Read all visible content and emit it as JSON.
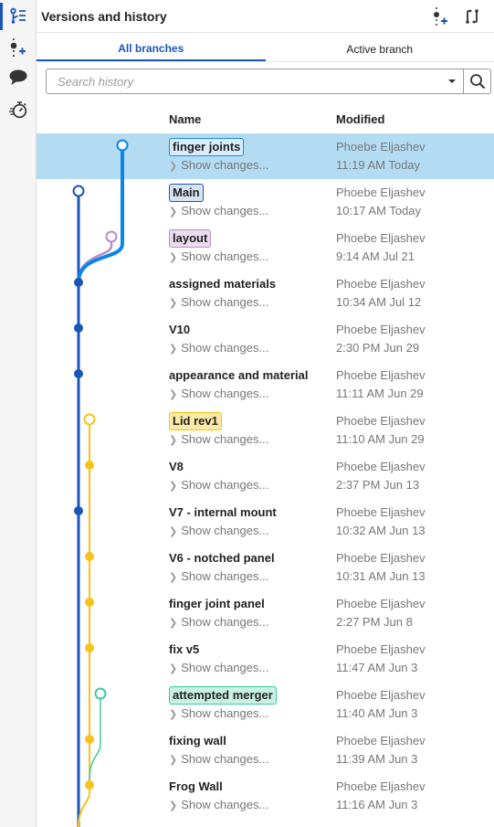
{
  "rail": {
    "items": [
      {
        "name": "versions-history",
        "active": true
      },
      {
        "name": "create-version",
        "active": false
      },
      {
        "name": "comments",
        "active": false
      },
      {
        "name": "performance",
        "active": false
      }
    ]
  },
  "header": {
    "title": "Versions and history",
    "actions": [
      "create-version-icon",
      "branch-compare-icon"
    ]
  },
  "tabs": [
    {
      "label": "All branches",
      "active": true
    },
    {
      "label": "Active branch",
      "active": false
    }
  ],
  "search": {
    "placeholder": "Search history",
    "value": ""
  },
  "columns": {
    "name": "Name",
    "modified": "Modified"
  },
  "colors": {
    "accent": "#1a56b8",
    "selected_row": "#b3dcf3",
    "branch_main": "#1a56b8",
    "branch_finger_joints": "#0a86e8",
    "branch_layout": "#b98cc7",
    "branch_lid": "#f7c31a",
    "branch_merger": "#3ec99f"
  },
  "show_changes_label": "Show changes...",
  "versions": [
    {
      "name": "finger joints",
      "branch_badge": true,
      "badge_bg": "#d8ecfb",
      "badge_border": "#1a8ae0",
      "author": "Phoebe Eljashev",
      "time": "11:19 AM Today",
      "selected": true
    },
    {
      "name": "Main",
      "branch_badge": true,
      "badge_bg": "#d7e3f3",
      "badge_border": "#1a56b8",
      "author": "Phoebe Eljashev",
      "time": "10:17 AM Today"
    },
    {
      "name": "layout",
      "branch_badge": true,
      "badge_bg": "#eadcef",
      "badge_border": "#b98cc7",
      "author": "Phoebe Eljashev",
      "time": "9:14 AM Jul 21"
    },
    {
      "name": "assigned materials",
      "branch_badge": false,
      "author": "Phoebe Eljashev",
      "time": "10:34 AM Jul 12"
    },
    {
      "name": "V10",
      "branch_badge": false,
      "author": "Phoebe Eljashev",
      "time": "2:30 PM Jun 29"
    },
    {
      "name": "appearance and material",
      "branch_badge": false,
      "author": "Phoebe Eljashev",
      "time": "11:11 AM Jun 29"
    },
    {
      "name": "Lid rev1",
      "branch_badge": true,
      "badge_bg": "#fde9a6",
      "badge_border": "#f7c31a",
      "author": "Phoebe Eljashev",
      "time": "11:10 AM Jun 29"
    },
    {
      "name": "V8",
      "branch_badge": false,
      "author": "Phoebe Eljashev",
      "time": "2:37 PM Jun 13"
    },
    {
      "name": "V7 - internal mount",
      "branch_badge": false,
      "author": "Phoebe Eljashev",
      "time": "10:32 AM Jun 13"
    },
    {
      "name": "V6 - notched panel",
      "branch_badge": false,
      "author": "Phoebe Eljashev",
      "time": "10:31 AM Jun 13"
    },
    {
      "name": "finger joint panel",
      "branch_badge": false,
      "author": "Phoebe Eljashev",
      "time": "2:27 PM Jun 8"
    },
    {
      "name": "fix v5",
      "branch_badge": false,
      "author": "Phoebe Eljashev",
      "time": "11:47 AM Jun 3"
    },
    {
      "name": "attempted merger",
      "branch_badge": true,
      "badge_bg": "#c9f1e3",
      "badge_border": "#3ec99f",
      "author": "Phoebe Eljashev",
      "time": "11:40 AM Jun 3"
    },
    {
      "name": "fixing wall",
      "branch_badge": false,
      "author": "Phoebe Eljashev",
      "time": "11:39 AM Jun 3"
    },
    {
      "name": "Frog Wall",
      "branch_badge": false,
      "author": "Phoebe Eljashev",
      "time": "11:16 AM Jun 3"
    }
  ]
}
